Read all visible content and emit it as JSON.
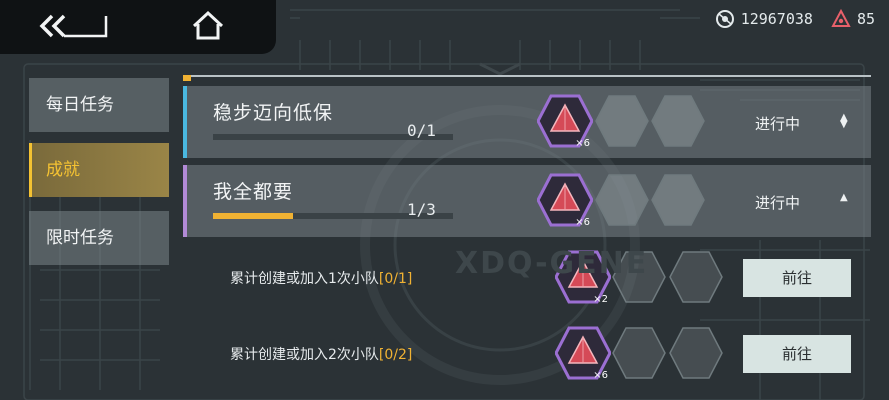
{
  "currency": {
    "coins_icon": "coin-icon",
    "coins": "12967038",
    "gems_icon": "crystal-icon",
    "gems": "85"
  },
  "background": {
    "watermark": "XDQ-GENE"
  },
  "sidebar": {
    "items": [
      {
        "label": "每日任务",
        "active": false
      },
      {
        "label": "成就",
        "active": true
      },
      {
        "label": "限时任务",
        "active": false
      }
    ]
  },
  "missions": [
    {
      "title": "稳步迈向低保",
      "progress_text": "0/1",
      "progress": 0,
      "status": "进行中",
      "arrow": "▲▼",
      "reward_count": "×6",
      "accent": "#4ab8e0"
    },
    {
      "title": "我全都要",
      "progress_text": "1/3",
      "progress": 0.333,
      "status": "进行中",
      "arrow": "▲",
      "reward_count": "×6",
      "accent": "#b28ad6"
    }
  ],
  "sub_tasks": [
    {
      "label_prefix": "累计创建或加入1次小队",
      "label_progress": "[0/1]",
      "reward_count": "×2",
      "button": "前往"
    },
    {
      "label_prefix": "累计创建或加入2次小队",
      "label_progress": "[0/2]",
      "reward_count": "×6",
      "button": "前往"
    }
  ],
  "colors": {
    "accent_gold": "#f0b233",
    "button_bg": "#d8e4e2",
    "reward_purple": "#9b6fd2"
  }
}
